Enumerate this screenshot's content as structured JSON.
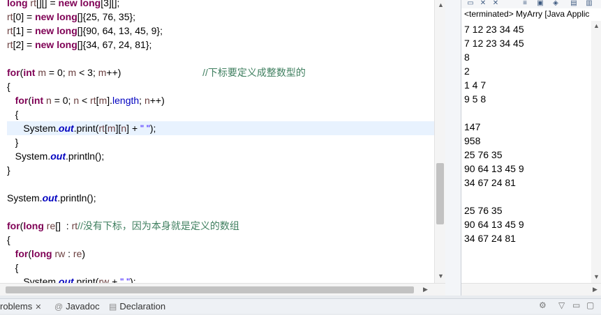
{
  "editor": {
    "lines": [
      {
        "segs": [
          [
            "kw",
            "long"
          ],
          [
            "var",
            " rt"
          ],
          [
            "",
            "[][] = "
          ],
          [
            "kw",
            "new"
          ],
          [
            "",
            ""
          ],
          [
            "kw",
            " long"
          ],
          [
            "",
            "[3][];"
          ]
        ]
      },
      {
        "segs": [
          [
            "var",
            "rt"
          ],
          [
            "",
            "[0] = "
          ],
          [
            "kw",
            "new"
          ],
          [
            "kw",
            " long"
          ],
          [
            "",
            "[]{25, 76, 35};"
          ]
        ]
      },
      {
        "segs": [
          [
            "var",
            "rt"
          ],
          [
            "",
            "[1] = "
          ],
          [
            "kw",
            "new"
          ],
          [
            "kw",
            " long"
          ],
          [
            "",
            "[]{90, 64, 13, 45, 9};"
          ]
        ]
      },
      {
        "segs": [
          [
            "var",
            "rt"
          ],
          [
            "",
            "[2] = "
          ],
          [
            "kw",
            "new"
          ],
          [
            "kw",
            " long"
          ],
          [
            "",
            "[]{34, 67, 24, 81};"
          ]
        ]
      },
      {
        "segs": []
      },
      {
        "segs": [
          [
            "kw",
            "for"
          ],
          [
            "",
            "("
          ],
          [
            "kw",
            "int"
          ],
          [
            "var",
            " m"
          ],
          [
            "",
            " = 0; "
          ],
          [
            "var",
            "m"
          ],
          [
            "",
            " < 3; "
          ],
          [
            "var",
            "m"
          ],
          [
            "",
            "++)                              "
          ],
          [
            "cmt",
            "//下标要定义成整数型的"
          ]
        ]
      },
      {
        "segs": [
          [
            "",
            "{"
          ]
        ]
      },
      {
        "segs": [
          [
            "",
            "   "
          ],
          [
            "kw",
            "for"
          ],
          [
            "",
            "("
          ],
          [
            "kw",
            "int"
          ],
          [
            "var",
            " n"
          ],
          [
            "",
            " = 0; "
          ],
          [
            "var",
            "n"
          ],
          [
            "",
            " < "
          ],
          [
            "var",
            "rt"
          ],
          [
            "",
            "["
          ],
          [
            "var",
            "m"
          ],
          [
            "",
            "]."
          ],
          [
            "fld2",
            "length"
          ],
          [
            "",
            "; "
          ],
          [
            "var",
            "n"
          ],
          [
            "",
            "++)"
          ]
        ]
      },
      {
        "segs": [
          [
            "",
            "   {"
          ]
        ]
      },
      {
        "segs": [
          [
            "",
            "      System."
          ],
          [
            "fld",
            "out"
          ],
          [
            "",
            ".print("
          ],
          [
            "var",
            "rt"
          ],
          [
            "",
            "["
          ],
          [
            "var",
            "m"
          ],
          [
            "",
            "]["
          ],
          [
            "var",
            "n"
          ],
          [
            "",
            "] + "
          ],
          [
            "str",
            "\" \""
          ],
          [
            "",
            ");"
          ]
        ],
        "current": true
      },
      {
        "segs": [
          [
            "",
            "   }"
          ]
        ]
      },
      {
        "segs": [
          [
            "",
            "   System."
          ],
          [
            "fld",
            "out"
          ],
          [
            "",
            ".println();"
          ]
        ]
      },
      {
        "segs": [
          [
            "",
            "}"
          ]
        ]
      },
      {
        "segs": []
      },
      {
        "segs": [
          [
            "",
            "System."
          ],
          [
            "fld",
            "out"
          ],
          [
            "",
            ".println();"
          ]
        ]
      },
      {
        "segs": []
      },
      {
        "segs": [
          [
            "kw",
            "for"
          ],
          [
            "",
            "("
          ],
          [
            "kw",
            "long"
          ],
          [
            "var",
            " re"
          ],
          [
            "",
            "[]  : "
          ],
          [
            "var",
            "rt"
          ],
          [
            ")                                        "
          ],
          [
            "cmt",
            "//没有下标，因为本身就是定义的数组"
          ]
        ]
      },
      {
        "segs": [
          [
            "",
            "{"
          ]
        ]
      },
      {
        "segs": [
          [
            "",
            "   "
          ],
          [
            "kw",
            "for"
          ],
          [
            "",
            "("
          ],
          [
            "kw",
            "long"
          ],
          [
            "var",
            " rw"
          ],
          [
            "",
            " : "
          ],
          [
            "var",
            "re"
          ],
          [
            "",
            ")"
          ]
        ]
      },
      {
        "segs": [
          [
            "",
            "   {"
          ]
        ]
      },
      {
        "segs": [
          [
            "",
            "      System."
          ],
          [
            "fld",
            "out"
          ],
          [
            "",
            ".print("
          ],
          [
            "var",
            "rw"
          ],
          [
            "",
            " + "
          ],
          [
            "str",
            "\" \""
          ],
          [
            "",
            ");"
          ]
        ]
      }
    ]
  },
  "console": {
    "status": "<terminated> MyArry [Java Applic",
    "output": [
      "7 12 23 34 45",
      "7 12 23 34 45",
      "8",
      "2",
      "1 4 7",
      "9 5 8",
      "",
      "147",
      "958",
      "25 76 35",
      "90 64 13 45 9",
      "34 67 24 81",
      "",
      "25 76 35",
      "90 64 13 45 9",
      "34 67 24 81"
    ]
  },
  "bottom_tabs": {
    "problems": "roblems",
    "javadoc": "Javadoc",
    "declaration": "Declaration"
  },
  "icons": {
    "close": "✕",
    "javadoc": "@",
    "declaration": "declaration-icon"
  }
}
